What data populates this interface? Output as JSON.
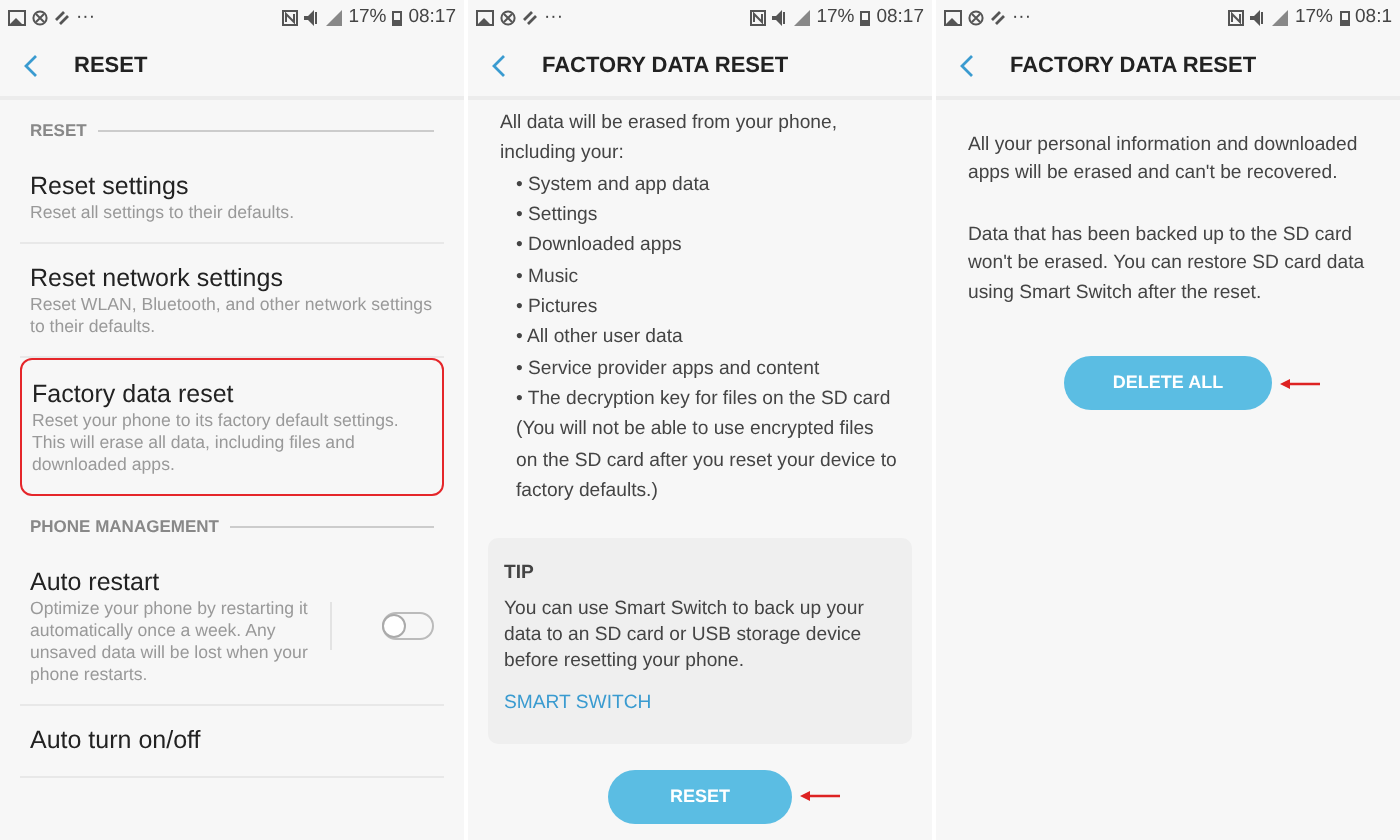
{
  "screens": [
    {
      "status": {
        "more": "···",
        "battery": "17%",
        "time": "08:17"
      },
      "title": "RESET",
      "kind": "settings",
      "sections": [
        {
          "header": "RESET",
          "items": [
            {
              "kind": "plain",
              "title": "Reset settings",
              "desc": "Reset all settings to their defaults.",
              "highlighted": false
            },
            {
              "kind": "plain",
              "title": "Reset network settings",
              "desc": "Reset WLAN, Bluetooth, and other network settings to their defaults.",
              "highlighted": false
            },
            {
              "kind": "plain",
              "title": "Factory data reset",
              "desc": "Reset your phone to its factory default settings. This will erase all data, including files and downloaded apps.",
              "highlighted": true
            }
          ]
        },
        {
          "header": "PHONE MANAGEMENT",
          "items": [
            {
              "kind": "toggle",
              "title": "Auto restart",
              "desc": "Optimize your phone by restarting it automatically once a week. Any unsaved data will be lost when your phone restarts.",
              "on": false,
              "highlighted": false
            },
            {
              "kind": "plain",
              "title": "Auto turn on/off",
              "highlighted": false
            }
          ]
        }
      ]
    },
    {
      "status": {
        "more": "···",
        "battery": "17%",
        "time": "08:17"
      },
      "title": "FACTORY DATA RESET",
      "kind": "details",
      "intro": "All data will be erased from your phone, including your:",
      "bullets": [
        "• System and app data",
        "• Settings",
        "• Downloaded apps",
        "• Music",
        "• Pictures",
        "• All other user data",
        "• Service provider apps and content",
        "• The decryption key for files on the SD card"
      ],
      "note": "(You will not be able to use encrypted files on the SD card after you reset your device to factory defaults.)",
      "tip": {
        "title": "TIP",
        "text": "You can use Smart Switch to back up your data to an SD card or USB storage device before resetting your phone.",
        "link": "SMART SWITCH"
      },
      "button": {
        "label": "RESET",
        "arrow": true
      }
    },
    {
      "status": {
        "more": "···",
        "battery": "17%",
        "time": "08:1"
      },
      "title": "FACTORY DATA RESET",
      "kind": "confirm",
      "paragraphs": [
        "All your personal information and downloaded apps will be erased and can't be recovered.",
        "Data that has been backed up to the SD card won't be erased. You can restore SD card data using Smart Switch after the reset."
      ],
      "button": {
        "label": "DELETE ALL",
        "arrow": true
      }
    }
  ]
}
